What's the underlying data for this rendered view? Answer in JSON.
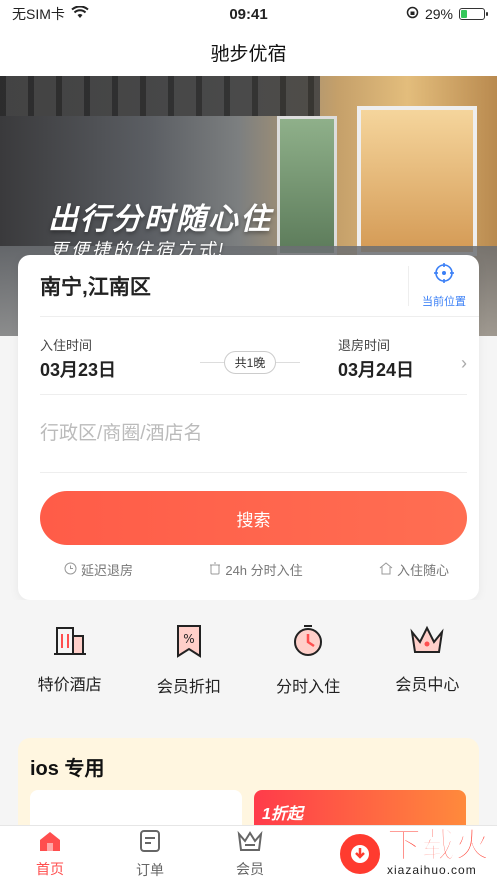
{
  "status": {
    "carrier": "无SIM卡",
    "time": "09:41",
    "battery": "29%",
    "battery_level": 0.29
  },
  "nav": {
    "title": "驰步优宿"
  },
  "hero": {
    "title": "出行分时随心住",
    "subtitle": "更便捷的住宿方式!"
  },
  "booking": {
    "location": "南宁,江南区",
    "locate_label": "当前位置",
    "checkin_label": "入住时间",
    "checkin_date": "03月23日",
    "checkout_label": "退房时间",
    "checkout_date": "03月24日",
    "nights": "共1晚",
    "keyword_placeholder": "行政区/商圈/酒店名",
    "search_label": "搜索",
    "features": [
      "延迟退房",
      "24h 分时入住",
      "入住随心"
    ]
  },
  "quick": [
    {
      "label": "特价酒店",
      "icon": "hotel-icon"
    },
    {
      "label": "会员折扣",
      "icon": "discount-icon"
    },
    {
      "label": "分时入住",
      "icon": "clock-icon"
    },
    {
      "label": "会员中心",
      "icon": "crown-icon"
    }
  ],
  "promo": {
    "title": "ios 专用",
    "tag": "1折起"
  },
  "tabs": [
    {
      "label": "首页",
      "icon": "home-icon",
      "active": true
    },
    {
      "label": "订单",
      "icon": "order-icon",
      "active": false
    },
    {
      "label": "会员",
      "icon": "member-icon",
      "active": false
    }
  ],
  "watermark": {
    "text": "下载火",
    "url": "xiazaihuo.com"
  },
  "colors": {
    "accent": "#ff5c48",
    "link": "#3a7ff6",
    "active_tab": "#ff4e4e"
  }
}
